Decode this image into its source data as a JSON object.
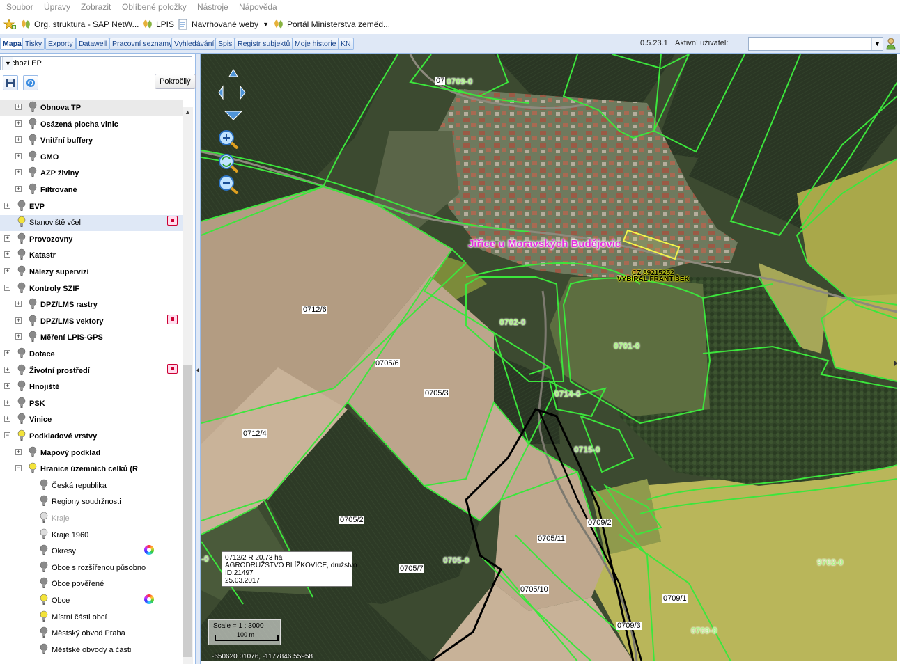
{
  "menu": [
    "Soubor",
    "Úpravy",
    "Zobrazit",
    "Oblíbené položky",
    "Nástroje",
    "Nápověda"
  ],
  "favorites": [
    "Org. struktura - SAP NetW...",
    "LPIS",
    "Navrhované weby",
    "Portál Ministerstva zeměd..."
  ],
  "tabs": [
    "Mapa",
    "Tisky",
    "Exporty",
    "Datawell",
    "Pracovní seznamy",
    "Vyhledávání",
    "Spis",
    "Registr subjektů",
    "Moje historie",
    "KN"
  ],
  "version": "0.5.23.1",
  "active_user_label": "Aktivní uživatel:",
  "active_user_value": "",
  "sidebar": {
    "ep_select": "Výchozí EP",
    "advanced_button": "Pokročilý",
    "tree": [
      {
        "label": "Obnova TP",
        "level": 1,
        "bold": true,
        "expander": "+",
        "bulb": "gray"
      },
      {
        "label": "Osázená plocha vinic",
        "level": 1,
        "bold": true,
        "expander": "+",
        "bulb": "gray"
      },
      {
        "label": "Vnitřní buffery",
        "level": 1,
        "bold": true,
        "expander": "+",
        "bulb": "gray"
      },
      {
        "label": "GMO",
        "level": 1,
        "bold": true,
        "expander": "+",
        "bulb": "gray"
      },
      {
        "label": "AZP živiny",
        "level": 1,
        "bold": true,
        "expander": "+",
        "bulb": "gray"
      },
      {
        "label": "Filtrované",
        "level": 1,
        "bold": true,
        "expander": "+",
        "bulb": "gray"
      },
      {
        "label": "EVP",
        "level": 0,
        "bold": true,
        "expander": "+",
        "bulb": "gray"
      },
      {
        "label": "Stanoviště včel",
        "level": 0,
        "bold": false,
        "expander": "",
        "bulb": "yellow",
        "selected": true,
        "icon": true
      },
      {
        "label": "Provozovny",
        "level": 0,
        "bold": true,
        "expander": "+",
        "bulb": "gray"
      },
      {
        "label": "Katastr",
        "level": 0,
        "bold": true,
        "expander": "+",
        "bulb": "gray"
      },
      {
        "label": "Nálezy supervizí",
        "level": 0,
        "bold": true,
        "expander": "+",
        "bulb": "gray"
      },
      {
        "label": "Kontroly SZIF",
        "level": 0,
        "bold": true,
        "expander": "−",
        "bulb": "gray"
      },
      {
        "label": "DPZ/LMS rastry",
        "level": 1,
        "bold": true,
        "expander": "+",
        "bulb": "gray"
      },
      {
        "label": "DPZ/LMS vektory",
        "level": 1,
        "bold": true,
        "expander": "+",
        "bulb": "gray",
        "icon": true
      },
      {
        "label": "Měření LPIS-GPS",
        "level": 1,
        "bold": true,
        "expander": "+",
        "bulb": "gray"
      },
      {
        "label": "Dotace",
        "level": 0,
        "bold": true,
        "expander": "+",
        "bulb": "gray"
      },
      {
        "label": "Životní prostředí",
        "level": 0,
        "bold": true,
        "expander": "+",
        "bulb": "gray",
        "icon": true
      },
      {
        "label": "Hnojiště",
        "level": 0,
        "bold": true,
        "expander": "+",
        "bulb": "gray"
      },
      {
        "label": "PSK",
        "level": 0,
        "bold": true,
        "expander": "+",
        "bulb": "gray"
      },
      {
        "label": "Vinice",
        "level": 0,
        "bold": true,
        "expander": "+",
        "bulb": "gray"
      },
      {
        "label": "Podkladové vrstvy",
        "level": 0,
        "bold": true,
        "expander": "−",
        "bulb": "yellow"
      },
      {
        "label": "Mapový podklad",
        "level": 1,
        "bold": true,
        "expander": "+",
        "bulb": "gray"
      },
      {
        "label": "Hranice územních celků (R",
        "level": 1,
        "bold": true,
        "expander": "−",
        "bulb": "yellow"
      },
      {
        "label": "Česká republika",
        "level": 2,
        "bold": false,
        "expander": "",
        "bulb": "gray"
      },
      {
        "label": "Regiony soudržnosti",
        "level": 2,
        "bold": false,
        "expander": "",
        "bulb": "gray"
      },
      {
        "label": "Kraje",
        "level": 2,
        "bold": false,
        "expander": "",
        "bulb": "faint",
        "dim": true
      },
      {
        "label": "Kraje 1960",
        "level": 2,
        "bold": false,
        "expander": "",
        "bulb": "faint"
      },
      {
        "label": "Okresy",
        "level": 2,
        "bold": false,
        "expander": "",
        "bulb": "gray",
        "wheel": true
      },
      {
        "label": "Obce s rozšířenou působno",
        "level": 2,
        "bold": false,
        "expander": "",
        "bulb": "gray"
      },
      {
        "label": "Obce pověřené",
        "level": 2,
        "bold": false,
        "expander": "",
        "bulb": "gray"
      },
      {
        "label": "Obce",
        "level": 2,
        "bold": false,
        "expander": "",
        "bulb": "yellow",
        "wheel": true
      },
      {
        "label": "Místní části obcí",
        "level": 2,
        "bold": false,
        "expander": "",
        "bulb": "yellow"
      },
      {
        "label": "Městský obvod Praha",
        "level": 2,
        "bold": false,
        "expander": "",
        "bulb": "gray"
      },
      {
        "label": "Městské obvody a části",
        "level": 2,
        "bold": false,
        "expander": "",
        "bulb": "gray"
      }
    ]
  },
  "map": {
    "town": "Jiřice u Moravských Budějovic",
    "cz_code": "CZ 89215252",
    "owner": "VYBÍRAL FRANTIŠEK",
    "parcels": [
      {
        "text": "07",
        "type": "white"
      },
      {
        "text": "0709-0",
        "type": "green"
      },
      {
        "text": "0712/6",
        "type": "white"
      },
      {
        "text": "0702-0",
        "type": "green"
      },
      {
        "text": "0701-0",
        "type": "green"
      },
      {
        "text": "0705/6",
        "type": "white"
      },
      {
        "text": "0705/3",
        "type": "white"
      },
      {
        "text": "0714-0",
        "type": "green"
      },
      {
        "text": "0712/4",
        "type": "white"
      },
      {
        "text": "0715-0",
        "type": "green"
      },
      {
        "text": "0709/2",
        "type": "white"
      },
      {
        "text": "0705/2",
        "type": "white"
      },
      {
        "text": "0705/11",
        "type": "white"
      },
      {
        "text": "0705-0",
        "type": "green"
      },
      {
        "text": "0705/7",
        "type": "white"
      },
      {
        "text": "9702-0",
        "type": "green"
      },
      {
        "text": "0705/10",
        "type": "white"
      },
      {
        "text": "0709/1",
        "type": "white"
      },
      {
        "text": "0709/3",
        "type": "white"
      },
      {
        "text": "0709-0",
        "type": "green"
      },
      {
        "text": "-0",
        "type": "green"
      }
    ],
    "info": [
      "0712/2 R 20,73 ha",
      "AGRODRUŽSTVO BLÍŽKOVICE, družstvo",
      "ID:21497",
      "25.03.2017"
    ],
    "scale": "Scale = 1 : 3000",
    "scalebar": "100 m",
    "coords": "-650620.01076, -1177846.55958"
  },
  "colors": {
    "parcel_line": "#3ce63c",
    "town_label": "#e62ee0",
    "highlight": "#f4f44a",
    "tab_bg": "#dfe8f6",
    "tab_text": "#15428b"
  }
}
